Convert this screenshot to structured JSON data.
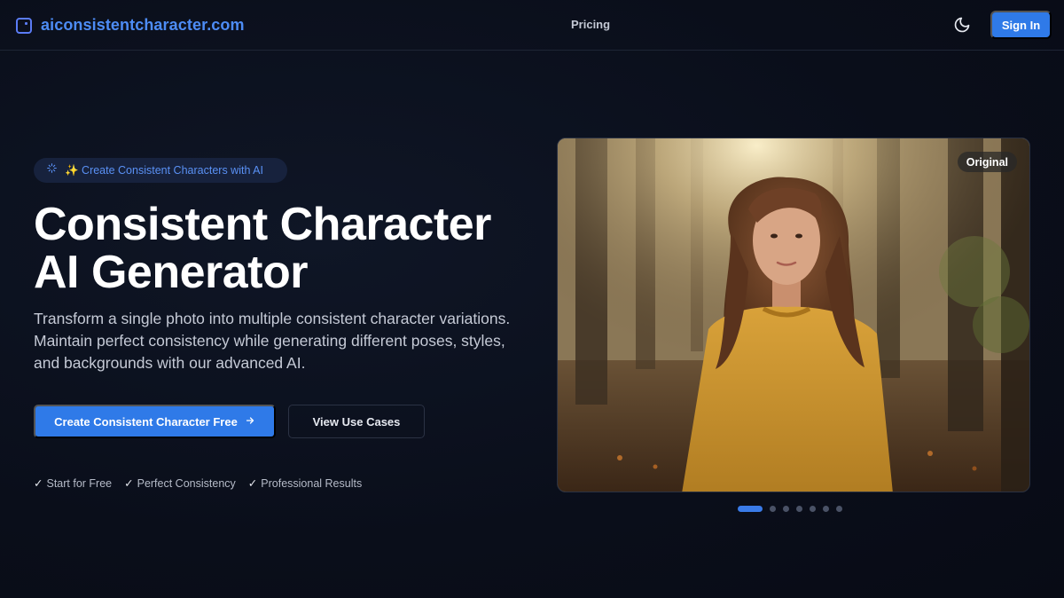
{
  "header": {
    "logo_text": "aiconsistentcharacter.com",
    "nav_pricing": "Pricing",
    "signin_label": "Sign In",
    "theme_icon": "moon-icon"
  },
  "hero": {
    "badge_text": "✨ Create Consistent Characters with AI",
    "title_line1": "Consistent Character",
    "title_line2": "AI Generator",
    "subtitle": "Transform a single photo into multiple consistent character variations. Maintain perfect consistency while generating different poses, styles, and backgrounds with our advanced AI.",
    "primary_button": "Create Consistent Character Free",
    "secondary_button": "View Use Cases",
    "features": [
      "Start for Free",
      "Perfect Consistency",
      "Professional Results"
    ]
  },
  "carousel": {
    "image_label": "Original",
    "image_subject": "woman in yellow sweater in sunlit forest",
    "slide_count": 7,
    "active_slide": 1
  },
  "colors": {
    "accent": "#2f7ae8",
    "logo": "#4d8cf5",
    "background": "#0a0e1a"
  }
}
